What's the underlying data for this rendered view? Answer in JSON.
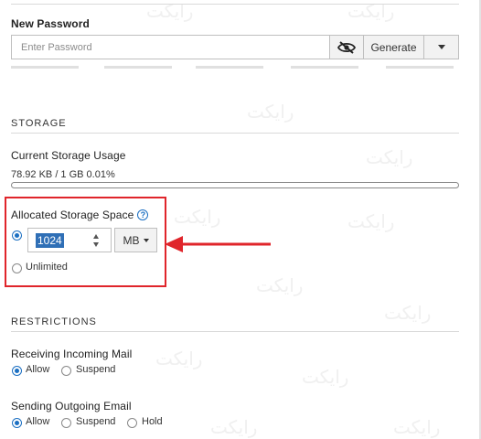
{
  "password": {
    "label": "New Password",
    "placeholder": "Enter Password",
    "generate_label": "Generate"
  },
  "storage": {
    "section_title": "STORAGE",
    "usage_label": "Current Storage Usage",
    "usage_text": "78.92 KB / 1 GB 0.01%",
    "usage_fraction": 0.0001,
    "allocated_label": "Allocated Storage Space",
    "help_glyph": "?",
    "allocated_value": "1024",
    "unit": "MB",
    "unlimited_label": "Unlimited"
  },
  "restrictions": {
    "section_title": "RESTRICTIONS",
    "incoming_label": "Receiving Incoming Mail",
    "incoming_options": [
      "Allow",
      "Suspend"
    ],
    "outgoing_label": "Sending Outgoing Email",
    "outgoing_options": [
      "Allow",
      "Suspend",
      "Hold"
    ]
  },
  "colors": {
    "accent": "#1b6fc2",
    "annotation": "#e0252b"
  },
  "icons": {
    "visibility_toggle": "eye-slash-icon",
    "dropdown": "chevron-down-icon",
    "help": "question-circle-icon",
    "annotation": "arrow-left-icon"
  },
  "watermark": "رایکت"
}
